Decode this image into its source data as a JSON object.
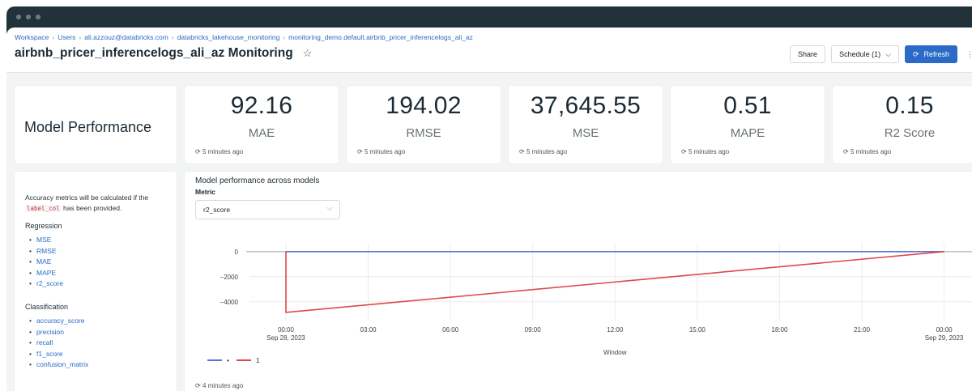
{
  "breadcrumb": [
    "Workspace",
    "Users",
    "ali.azzouz@databricks.com",
    "databricks_lakehouse_monitoring",
    "monitoring_demo.default.airbnb_pricer_inferencelogs_ali_az"
  ],
  "page_title": "airbnb_pricer_inferencelogs_ali_az Monitoring",
  "actions": {
    "share": "Share",
    "schedule": "Schedule (1)",
    "refresh": "Refresh"
  },
  "performance_title": "Model Performance",
  "kpis": [
    {
      "value": "92.16",
      "label": "MAE",
      "time": "5 minutes ago"
    },
    {
      "value": "194.02",
      "label": "RMSE",
      "time": "5 minutes ago"
    },
    {
      "value": "37,645.55",
      "label": "MSE",
      "time": "5 minutes ago"
    },
    {
      "value": "0.51",
      "label": "MAPE",
      "time": "5 minutes ago"
    },
    {
      "value": "0.15",
      "label": "R2 Score",
      "time": "5 minutes ago"
    }
  ],
  "sidebar": {
    "intro_before": "Accuracy metrics will be calculated if the",
    "intro_code": "label_col",
    "intro_after": "has been provided.",
    "regression_heading": "Regression",
    "regression_items": [
      "MSE",
      "RMSE",
      "MAE",
      "MAPE",
      "r2_score"
    ],
    "classification_heading": "Classification",
    "classification_items": [
      "accuracy_score",
      "precision",
      "recall",
      "f1_score",
      "confusion_matrix"
    ]
  },
  "chart_panel": {
    "title": "Model performance across models",
    "metric_label": "Metric",
    "metric_selected": "r2_score",
    "time": "4 minutes ago"
  },
  "chart_data": {
    "type": "line",
    "title": "",
    "xlabel": "Window",
    "ylabel": "",
    "x_ticks": [
      {
        "label": "00:00",
        "sub": "Sep 28, 2023",
        "h": 0
      },
      {
        "label": "03:00",
        "sub": "",
        "h": 3
      },
      {
        "label": "06:00",
        "sub": "",
        "h": 6
      },
      {
        "label": "09:00",
        "sub": "",
        "h": 9
      },
      {
        "label": "12:00",
        "sub": "",
        "h": 12
      },
      {
        "label": "15:00",
        "sub": "",
        "h": 15
      },
      {
        "label": "18:00",
        "sub": "",
        "h": 18
      },
      {
        "label": "21:00",
        "sub": "",
        "h": 21
      },
      {
        "label": "00:00",
        "sub": "Sep 29, 2023",
        "h": 24
      }
    ],
    "y_ticks": [
      0,
      -2000,
      -4000
    ],
    "xlim": [
      -3.1,
      25.4
    ],
    "ylim": [
      -5500,
      700
    ],
    "grid": true,
    "legend_placement": "bottom-left",
    "series": [
      {
        "name": "•",
        "color": "#5b73d9",
        "points": [
          [
            0,
            0
          ],
          [
            24,
            0
          ]
        ]
      },
      {
        "name": "1",
        "color": "#e0474c",
        "points": [
          [
            0,
            0
          ],
          [
            0,
            -4850
          ],
          [
            24,
            0
          ]
        ]
      }
    ]
  }
}
